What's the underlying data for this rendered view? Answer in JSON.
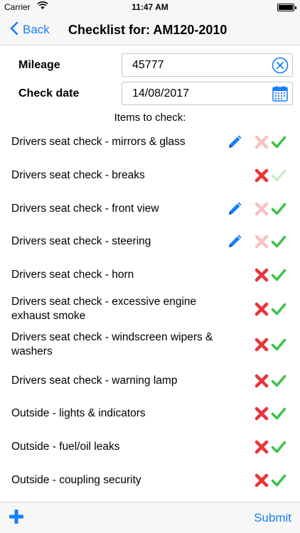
{
  "status_bar": {
    "carrier": "Carrier",
    "time": "11:47 AM"
  },
  "nav": {
    "back_label": "Back",
    "title": "Checklist for: AM120-2010"
  },
  "form": {
    "mileage": {
      "label": "Mileage",
      "value": "45777"
    },
    "check_date": {
      "label": "Check date",
      "value": "14/08/2017"
    }
  },
  "items_heading": "Items to check:",
  "items": [
    {
      "label": "Drivers seat check - mirrors & glass",
      "has_edit": true,
      "state": "ok"
    },
    {
      "label": "Drivers seat check - breaks",
      "has_edit": false,
      "state": "fail"
    },
    {
      "label": "Drivers seat check - front view",
      "has_edit": true,
      "state": "ok"
    },
    {
      "label": "Drivers seat check - steering",
      "has_edit": true,
      "state": "ok"
    },
    {
      "label": "Drivers seat check - horn",
      "has_edit": false,
      "state": "unset"
    },
    {
      "label": "Drivers seat check - excessive engine exhaust smoke",
      "has_edit": false,
      "state": "unset"
    },
    {
      "label": "Drivers seat check - windscreen wipers & washers",
      "has_edit": false,
      "state": "unset"
    },
    {
      "label": "Drivers seat check - warning lamp",
      "has_edit": false,
      "state": "unset"
    },
    {
      "label": "Outside - lights & indicators",
      "has_edit": false,
      "state": "unset"
    },
    {
      "label": "Outside - fuel/oil leaks",
      "has_edit": false,
      "state": "unset"
    },
    {
      "label": "Outside - coupling security",
      "has_edit": false,
      "state": "unset"
    }
  ],
  "toolbar": {
    "submit_label": "Submit",
    "add_icon": "plus-icon"
  },
  "colors": {
    "accent": "#157efb",
    "fail": "#e8363b",
    "ok": "#3ec24a",
    "faded_fail": "#f7c2c3",
    "faded_ok": "#c8efcb"
  }
}
